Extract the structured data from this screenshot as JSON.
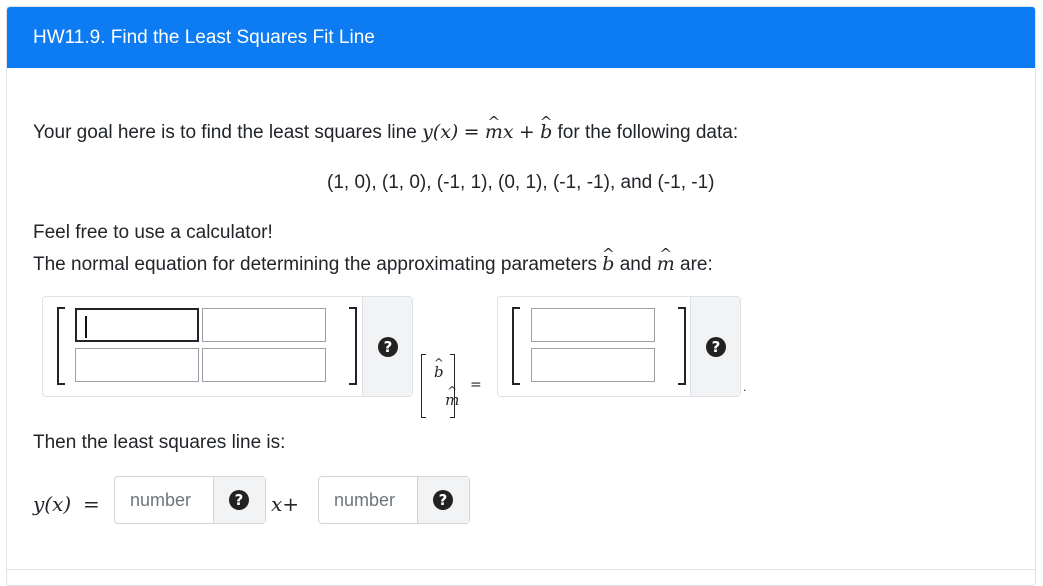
{
  "header": {
    "title": "HW11.9. Find the Least Squares Fit Line"
  },
  "prompt": {
    "intro_before": "Your goal here is to find the least squares line",
    "intro_math_lhs": "y(x)",
    "intro_math_eq": "=",
    "intro_math_m": "m",
    "intro_math_x": "x",
    "intro_math_plus": "+",
    "intro_math_b": "b",
    "intro_after": "for the following data:",
    "data_points": "(1, 0), (1, 0), (-1, 1), (0, 1), (-1, -1), and (-1, -1)",
    "calculator_note": "Feel free to use a calculator!",
    "normal_eq_before": "The normal equation for determining the approximating parameters",
    "normal_eq_b": "b",
    "normal_eq_and": "and",
    "normal_eq_m": "m",
    "normal_eq_after": "are:"
  },
  "matrix_a": {
    "cells": [
      "",
      "",
      "",
      ""
    ]
  },
  "vector_x": {
    "top": "b",
    "bottom": "m"
  },
  "equals": "=",
  "vector_rhs": {
    "cells": [
      "",
      ""
    ]
  },
  "period": ".",
  "result": {
    "label": "Then the least squares line is:",
    "lhs": "y(x)",
    "eq": "=",
    "slope_placeholder": "number",
    "x_term": "x+",
    "intercept_placeholder": "number"
  },
  "icons": {
    "help": "question-circle-icon",
    "help_glyph": "?"
  },
  "colors": {
    "header_bg": "#0d7bf2",
    "header_text": "#ffffff"
  }
}
